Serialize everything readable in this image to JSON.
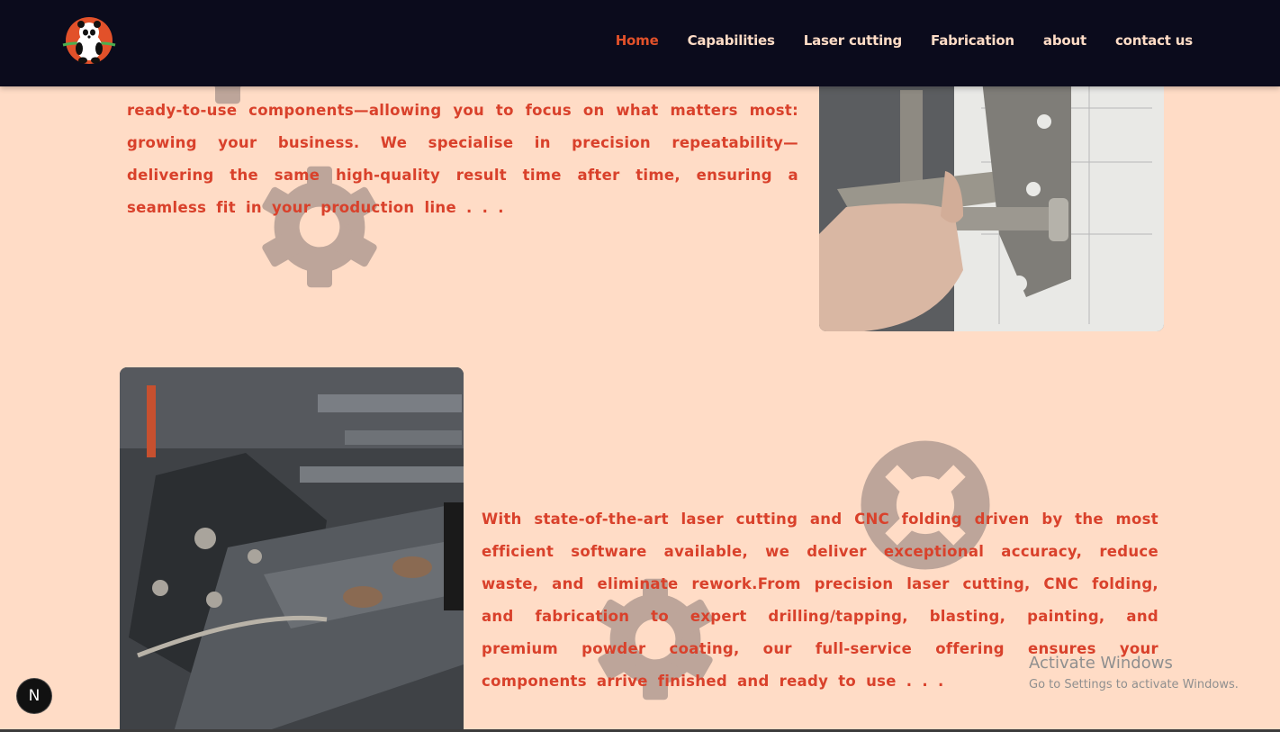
{
  "nav": {
    "logo_alt": "panda logo",
    "links": [
      {
        "label": "Home",
        "active": true
      },
      {
        "label": "Capabilities"
      },
      {
        "label": "Laser cutting"
      },
      {
        "label": "Fabrication"
      },
      {
        "label": "about"
      },
      {
        "label": "contact us"
      }
    ]
  },
  "section1": {
    "text": "ready-to-use components—allowing you to focus on what matters most: growing your business. We specialise in precision repeatability—delivering the same high-quality result time after time, ensuring a seamless fit in your production line . . ."
  },
  "section2": {
    "text": "With state-of-the-art laser cutting and CNC folding driven by the most efficient software available, we deliver exceptional accuracy, reduce waste, and eliminate rework.From precision laser cutting, CNC folding, and fabrication to expert drilling/tapping, blasting, painting, and premium powder coating, our full-service offering ensures your components arrive finished and ready to use . . ."
  },
  "overlay": {
    "activate_title": "Activate Windows",
    "activate_sub": "Go to Settings to activate Windows.",
    "next_badge": "N"
  },
  "colors": {
    "background": "#ffdcc6",
    "nav_bg": "#0b0b1c",
    "accent": "#e2512a",
    "text": "#d9412b",
    "gear": "#bda59a"
  }
}
